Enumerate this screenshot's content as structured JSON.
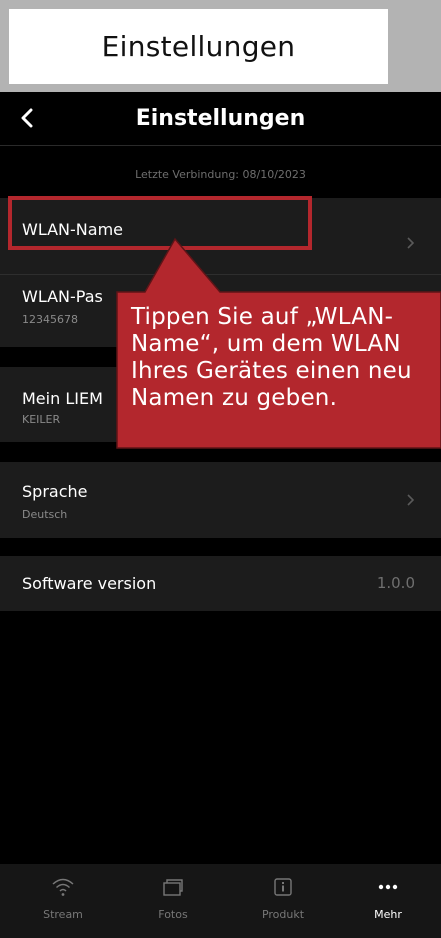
{
  "caption": "Einstellungen",
  "header": {
    "title": "Einstellungen",
    "back_icon": "chevron-left-icon"
  },
  "last_connection": "Letzte Verbindung: 08/10/2023",
  "settings": {
    "wlan_name": {
      "label": "WLAN-Name"
    },
    "wlan_password": {
      "label": "WLAN-Pas",
      "value": "12345678"
    },
    "my_device": {
      "label": "Mein LIEM",
      "value": "KEILER"
    },
    "language": {
      "label": "Sprache",
      "value": "Deutsch"
    },
    "software": {
      "label": "Software version",
      "value": "1.0.0"
    }
  },
  "tooltip": {
    "text": "Tippen Sie auf „WLAN-\nName“, um dem WLAN\nIhres Gerätes einen neu\nNamen zu geben.",
    "color": "#b3272d"
  },
  "tabs": [
    {
      "label": "Stream",
      "icon": "wifi-icon",
      "active": false
    },
    {
      "label": "Fotos",
      "icon": "photos-icon",
      "active": false
    },
    {
      "label": "Produkt",
      "icon": "info-icon",
      "active": false
    },
    {
      "label": "Mehr",
      "icon": "more-icon",
      "active": true
    }
  ],
  "colors": {
    "background": "#000000",
    "row": "#1c1c1c",
    "highlight": "#b3272d",
    "outer": "#b3b3b3"
  }
}
